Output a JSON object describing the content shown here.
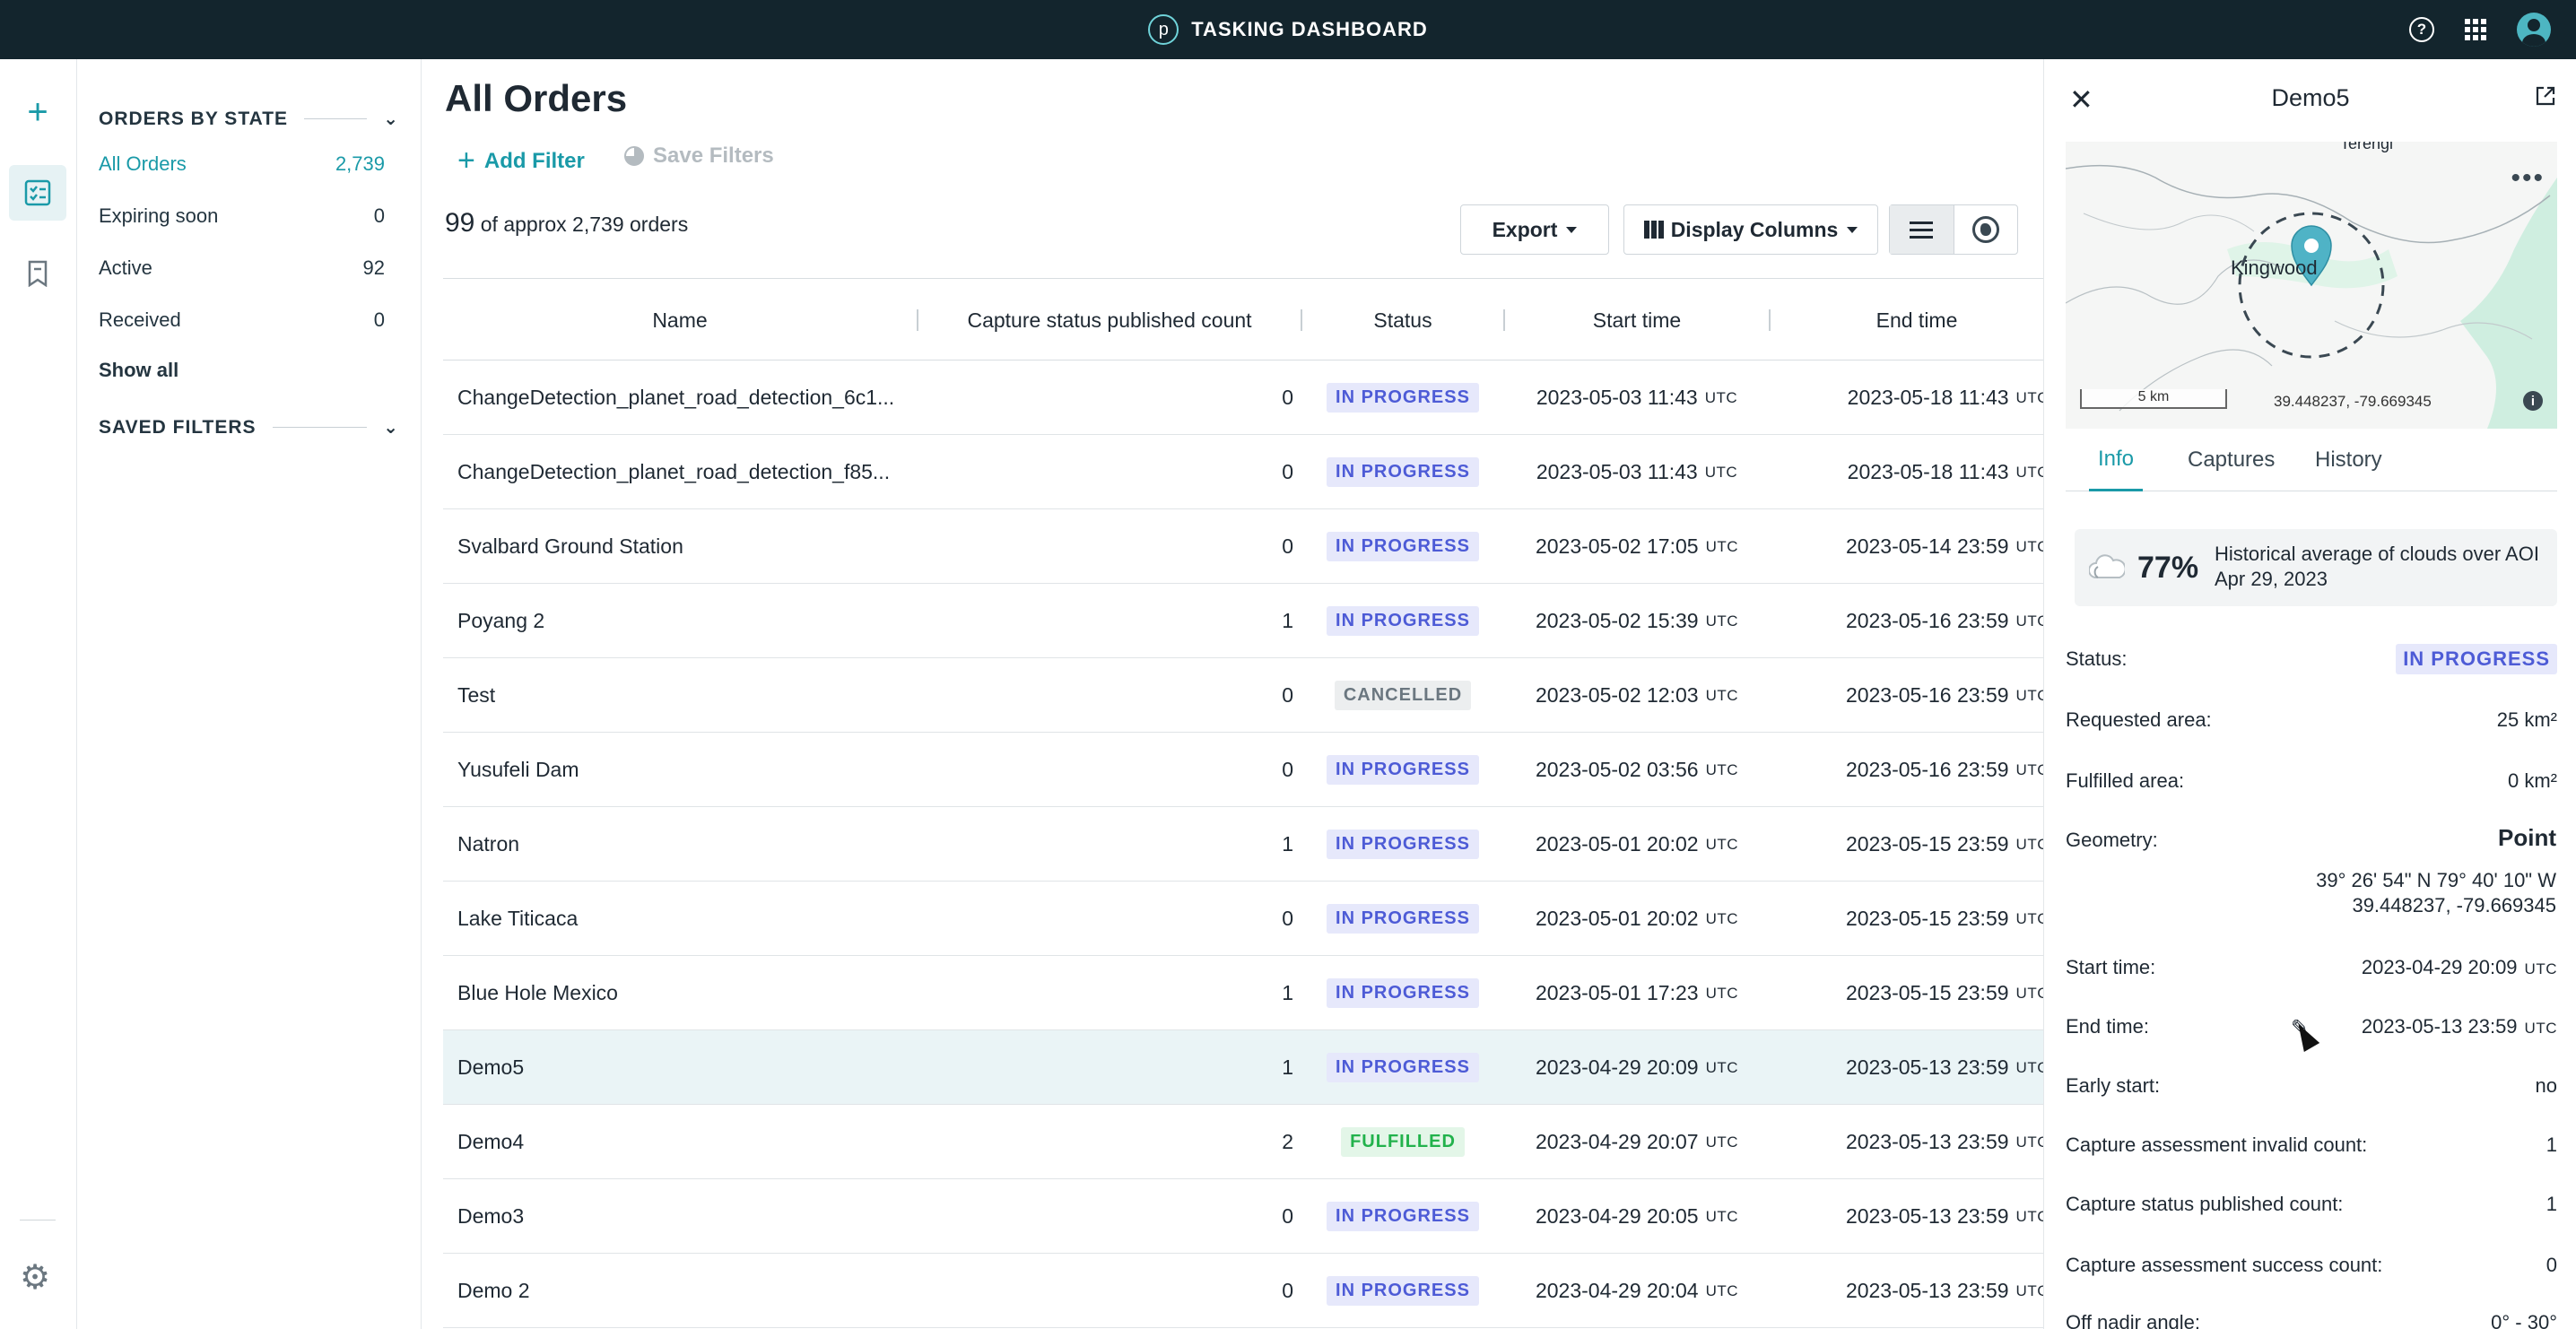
{
  "header": {
    "logo_letter": "p",
    "title": "TASKING DASHBOARD",
    "icons": [
      "help-icon",
      "apps-grid-icon",
      "user-avatar"
    ]
  },
  "rail": {
    "icons": [
      "plus-icon",
      "orders-list-icon",
      "bookmark-icon",
      "gear-icon"
    ]
  },
  "sidebar": {
    "orders_by_state": "ORDERS BY STATE",
    "items": [
      {
        "label": "All Orders",
        "count": "2,739",
        "active": true
      },
      {
        "label": "Expiring soon",
        "count": "0"
      },
      {
        "label": "Active",
        "count": "92"
      },
      {
        "label": "Received",
        "count": "0"
      }
    ],
    "show_all": "Show all",
    "saved_filters": "SAVED FILTERS"
  },
  "main": {
    "title": "All Orders",
    "add_filter": "Add Filter",
    "save_filters": "Save Filters",
    "count": "99",
    "count_suffix": "of approx 2,739 orders",
    "export": "Export",
    "display_columns": "Display Columns",
    "columns": {
      "name": "Name",
      "capture": "Capture status published count",
      "status": "Status",
      "start": "Start time",
      "end": "End time"
    },
    "utc": "UTC",
    "rows": [
      {
        "name": "ChangeDetection_planet_road_detection_6c1...",
        "count": "0",
        "status": "IN PROGRESS",
        "start": "2023-05-03 11:43",
        "end": "2023-05-18 11:43"
      },
      {
        "name": "ChangeDetection_planet_road_detection_f85...",
        "count": "0",
        "status": "IN PROGRESS",
        "start": "2023-05-03 11:43",
        "end": "2023-05-18 11:43"
      },
      {
        "name": "Svalbard Ground Station",
        "count": "0",
        "status": "IN PROGRESS",
        "start": "2023-05-02 17:05",
        "end": "2023-05-14 23:59"
      },
      {
        "name": "Poyang 2",
        "count": "1",
        "status": "IN PROGRESS",
        "start": "2023-05-02 15:39",
        "end": "2023-05-16 23:59"
      },
      {
        "name": "Test",
        "count": "0",
        "status": "CANCELLED",
        "start": "2023-05-02 12:03",
        "end": "2023-05-16 23:59"
      },
      {
        "name": "Yusufeli Dam",
        "count": "0",
        "status": "IN PROGRESS",
        "start": "2023-05-02 03:56",
        "end": "2023-05-16 23:59"
      },
      {
        "name": "Natron",
        "count": "1",
        "status": "IN PROGRESS",
        "start": "2023-05-01 20:02",
        "end": "2023-05-15 23:59"
      },
      {
        "name": "Lake Titicaca",
        "count": "0",
        "status": "IN PROGRESS",
        "start": "2023-05-01 20:02",
        "end": "2023-05-15 23:59"
      },
      {
        "name": "Blue Hole Mexico",
        "count": "1",
        "status": "IN PROGRESS",
        "start": "2023-05-01 17:23",
        "end": "2023-05-15 23:59"
      },
      {
        "name": "Demo5",
        "count": "1",
        "status": "IN PROGRESS",
        "start": "2023-04-29 20:09",
        "end": "2023-05-13 23:59",
        "selected": true
      },
      {
        "name": "Demo4",
        "count": "2",
        "status": "FULFILLED",
        "start": "2023-04-29 20:07",
        "end": "2023-05-13 23:59"
      },
      {
        "name": "Demo3",
        "count": "0",
        "status": "IN PROGRESS",
        "start": "2023-04-29 20:05",
        "end": "2023-05-13 23:59"
      },
      {
        "name": "Demo 2",
        "count": "0",
        "status": "IN PROGRESS",
        "start": "2023-04-29 20:04",
        "end": "2023-05-13 23:59"
      }
    ]
  },
  "panel": {
    "title": "Demo5",
    "map": {
      "label_top": "Terengi",
      "label_town": "Kingwood",
      "scale": "5 km",
      "coords": "39.448237, -79.669345"
    },
    "tabs": [
      "Info",
      "Captures",
      "History"
    ],
    "clouds": {
      "pct": "77%",
      "desc": "Historical average of clouds over AOI",
      "date": "Apr 29, 2023"
    },
    "fields": {
      "status_k": "Status:",
      "status_v": "IN PROGRESS",
      "req_k": "Requested area:",
      "req_v": "25 km²",
      "ful_k": "Fulfilled area:",
      "ful_v": "0 km²",
      "geo_k": "Geometry:",
      "geo_v": "Point",
      "geo_dms": "39° 26' 54\" N  79° 40' 10\" W",
      "geo_dec": "39.448237, -79.669345",
      "start_k": "Start time:",
      "start_v": "2023-04-29 20:09",
      "end_k": "End time:",
      "end_v": "2023-05-13 23:59",
      "early_k": "Early start:",
      "early_v": "no",
      "cai_k": "Capture assessment invalid count:",
      "cai_v": "1",
      "csp_k": "Capture status published count:",
      "csp_v": "1",
      "cas_k": "Capture assessment success count:",
      "cas_v": "0",
      "off_k": "Off nadir angle:",
      "off_v": "0° - 30°"
    }
  }
}
